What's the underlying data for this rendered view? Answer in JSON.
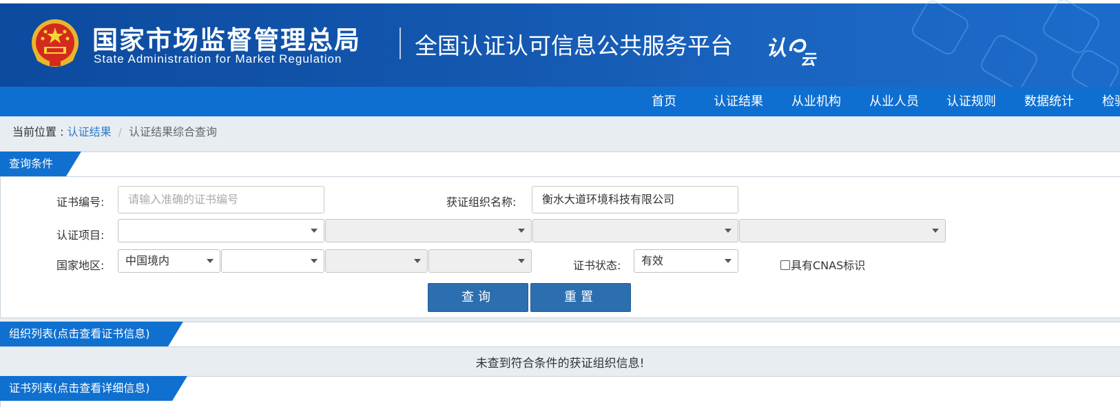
{
  "header": {
    "org_name_cn": "国家市场监督管理总局",
    "org_name_en": "State Administration  for  Market Regulation",
    "platform_title": "全国认证认可信息公共服务平台",
    "logo_text": "认e云",
    "colors": {
      "header_bg": "#1458b0",
      "nav_bg": "#0e6fd1",
      "tab_bg": "#1070d0",
      "button_bg": "#2c6fb0"
    }
  },
  "nav": {
    "items": [
      {
        "label": "首页"
      },
      {
        "label": "认证结果"
      },
      {
        "label": "从业机构"
      },
      {
        "label": "从业人员"
      },
      {
        "label": "认证规则"
      },
      {
        "label": "数据统计"
      },
      {
        "label": "检验"
      }
    ]
  },
  "breadcrumb": {
    "prefix": "当前位置 : ",
    "link": "认证结果",
    "separator": "/",
    "current": "认证结果综合查询"
  },
  "query": {
    "tab_label": "查询条件",
    "cert_no_label": "证书编号:",
    "cert_no_placeholder": "请输入准确的证书编号",
    "org_name_label": "获证组织名称:",
    "org_name_value": "衡水大道环境科技有限公司",
    "project_label": "认证项目:",
    "project_selects": [
      "",
      "",
      "",
      ""
    ],
    "region_label": "国家地区:",
    "region_selects": [
      "中国境内",
      "",
      "",
      ""
    ],
    "status_label": "证书状态:",
    "status_value": "有效",
    "cnas_label": "具有CNAS标识",
    "search_button": "查询",
    "reset_button": "重置"
  },
  "org_list": {
    "tab_label": "组织列表(点击查看证书信息)",
    "empty_message": "未查到符合条件的获证组织信息!"
  },
  "cert_list": {
    "tab_label": "证书列表(点击查看详细信息)"
  }
}
